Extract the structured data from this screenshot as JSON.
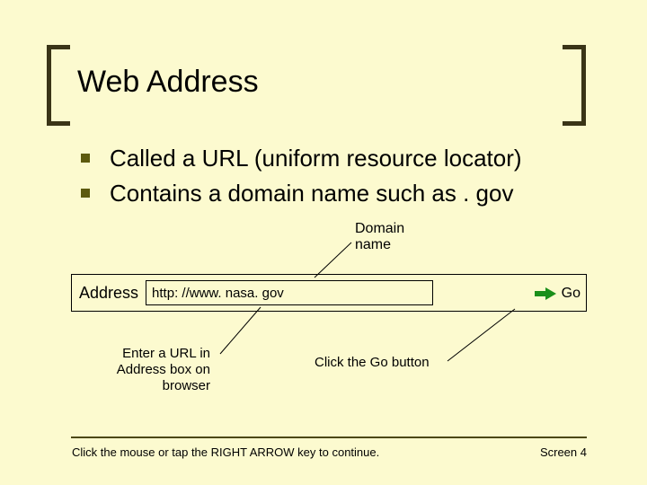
{
  "title": "Web Address",
  "bullets": [
    "Called a URL (uniform resource locator)",
    "Contains a domain name such as . gov"
  ],
  "labels": {
    "domain": "Domain\nname",
    "address": "Address",
    "url_value": "http: //www. nasa. gov",
    "go": "Go",
    "enter_url": "Enter a URL in Address box on browser",
    "click_go": "Click the Go button"
  },
  "footer": {
    "left": "Click the mouse or tap the RIGHT ARROW key to continue.",
    "right": "Screen 4"
  }
}
